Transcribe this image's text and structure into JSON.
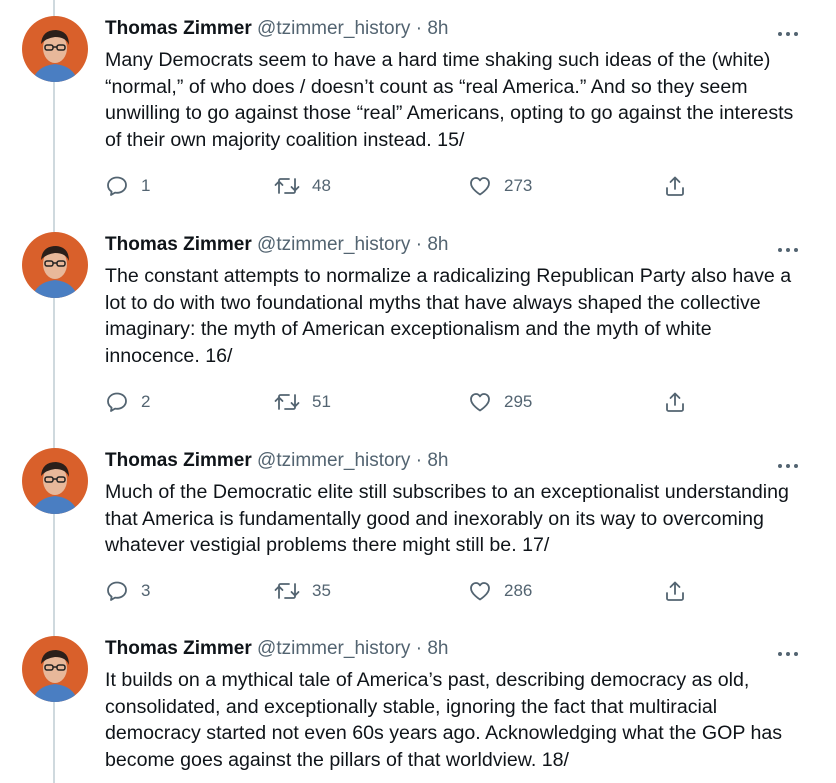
{
  "tweets": [
    {
      "name": "Thomas Zimmer",
      "handle": "@tzimmer_history",
      "separator": "·",
      "time": "8h",
      "text": "Many Democrats seem to have a hard time shaking such ideas of the (white) “normal,” of who does / doesn’t count as “real America.” And so they seem unwilling to go against those “real” Americans, opting to go against the interests of their own majority coalition instead. 15/",
      "replies": "1",
      "retweets": "48",
      "likes": "273"
    },
    {
      "name": "Thomas Zimmer",
      "handle": "@tzimmer_history",
      "separator": "·",
      "time": "8h",
      "text": "The constant attempts to normalize a radicalizing Republican Party also have a lot to do with two foundational myths that have always shaped the collective imaginary: the myth of American exceptionalism and the myth of white innocence. 16/",
      "replies": "2",
      "retweets": "51",
      "likes": "295"
    },
    {
      "name": "Thomas Zimmer",
      "handle": "@tzimmer_history",
      "separator": "·",
      "time": "8h",
      "text": "Much of the Democratic elite still subscribes to an exceptionalist understanding that America is fundamentally good and inexorably on its way to overcoming whatever vestigial problems there might still be. 17/",
      "replies": "3",
      "retweets": "35",
      "likes": "286"
    },
    {
      "name": "Thomas Zimmer",
      "handle": "@tzimmer_history",
      "separator": "·",
      "time": "8h",
      "text": "It builds on a mythical tale of America’s past, describing democracy as old, consolidated, and exceptionally stable, ignoring the fact that multiracial democracy started not even 60s years ago. Acknowledging what the GOP has become goes against the pillars of that worldview. 18/"
    }
  ],
  "icons": {
    "more": "more-horizontal-icon",
    "reply": "reply-icon",
    "retweet": "retweet-icon",
    "like": "heart-icon",
    "share": "share-icon"
  },
  "colors": {
    "text": "#0f1419",
    "secondary": "#536471",
    "thread_line": "#cfd9de",
    "avatar_bg": "#d9602b"
  }
}
